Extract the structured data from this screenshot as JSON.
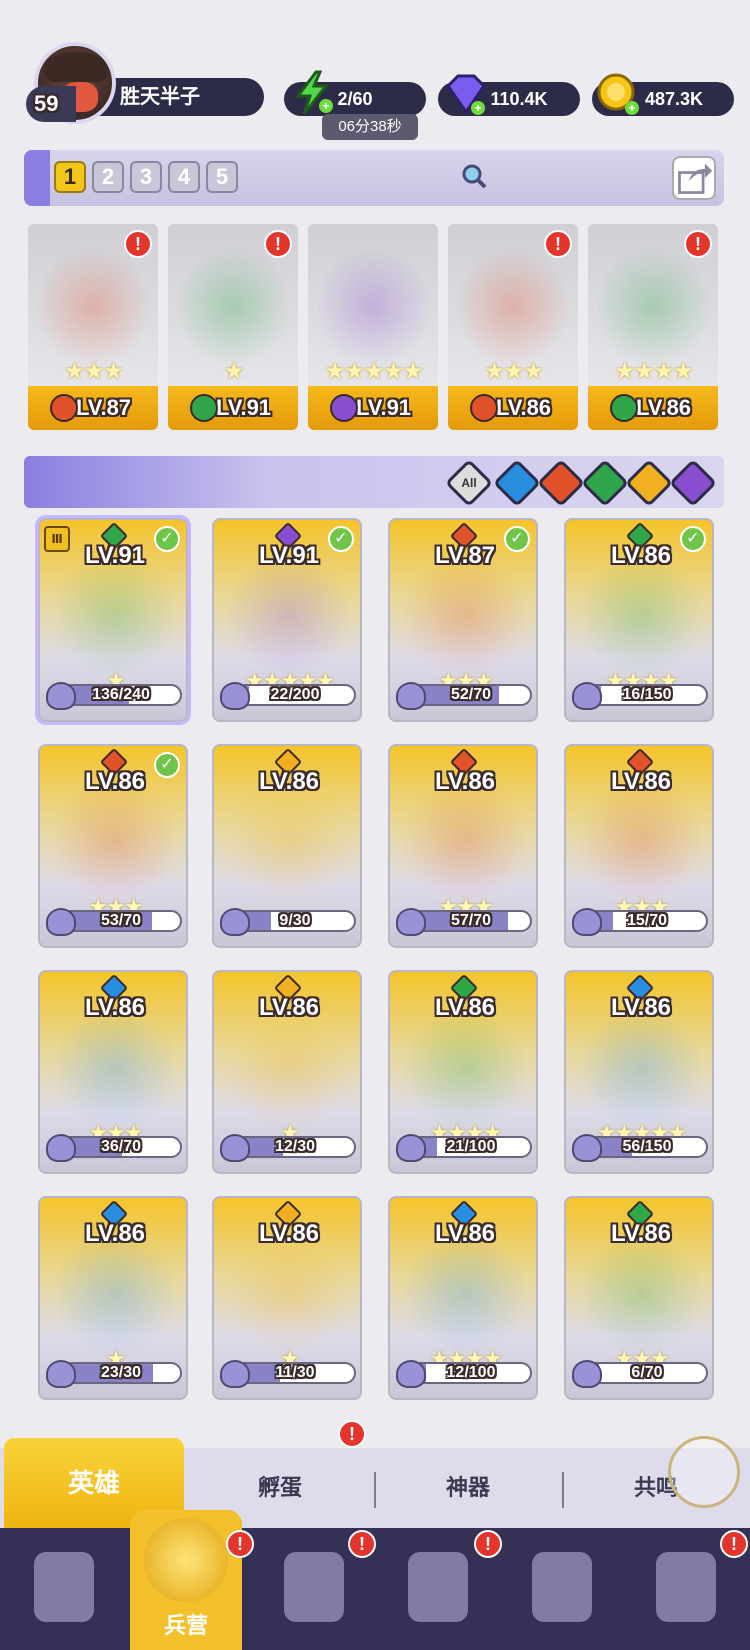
{
  "player": {
    "level": "59",
    "name": "胜天半子"
  },
  "resources": {
    "stamina": "2/60",
    "stamina_timer": "06分38秒",
    "gems": "110.4K",
    "gold": "487.3K"
  },
  "teams": {
    "tabs": [
      "1",
      "2",
      "3",
      "4",
      "5"
    ],
    "active": "1"
  },
  "team_cards": [
    {
      "level": "LV.87",
      "stars": "★★★",
      "element": "fire",
      "color": "#e2522a",
      "alert": "!"
    },
    {
      "level": "LV.91",
      "stars": "★",
      "element": "wind",
      "color": "#2fa64a",
      "alert": "!"
    },
    {
      "level": "LV.91",
      "stars": "★★★★★",
      "element": "dark",
      "color": "#8a4ed0",
      "alert": ""
    },
    {
      "level": "LV.86",
      "stars": "★★★",
      "element": "fire",
      "color": "#e2522a",
      "alert": "!"
    },
    {
      "level": "LV.86",
      "stars": "★★★★",
      "element": "wind",
      "color": "#2fa64a",
      "alert": "!"
    }
  ],
  "filters": {
    "all_label": "All",
    "elements": [
      "water",
      "fire",
      "wind",
      "light",
      "dark"
    ]
  },
  "heroes": [
    {
      "level": "LV.91",
      "stars": "★",
      "progress": "136/240",
      "ratio": 0.57,
      "element_color": "#2fa64a",
      "check": true,
      "selected": true
    },
    {
      "level": "LV.91",
      "stars": "★★★★★",
      "progress": "22/200",
      "ratio": 0.11,
      "element_color": "#8a4ed0",
      "check": true
    },
    {
      "level": "LV.87",
      "stars": "★★★",
      "progress": "52/70",
      "ratio": 0.74,
      "element_color": "#e2522a",
      "check": true
    },
    {
      "level": "LV.86",
      "stars": "★★★★",
      "progress": "16/150",
      "ratio": 0.11,
      "element_color": "#2fa64a",
      "check": true
    },
    {
      "level": "LV.86",
      "stars": "★★★",
      "progress": "53/70",
      "ratio": 0.76,
      "element_color": "#e2522a",
      "check": true
    },
    {
      "level": "LV.86",
      "stars": "",
      "progress": "9/30",
      "ratio": 0.3,
      "element_color": "#f0b020",
      "check": false
    },
    {
      "level": "LV.86",
      "stars": "★★★",
      "progress": "57/70",
      "ratio": 0.81,
      "element_color": "#e2522a",
      "check": false
    },
    {
      "level": "LV.86",
      "stars": "★★★",
      "progress": "15/70",
      "ratio": 0.21,
      "element_color": "#e2522a",
      "check": false
    },
    {
      "level": "LV.86",
      "stars": "★★★",
      "progress": "36/70",
      "ratio": 0.51,
      "element_color": "#2a8ee0",
      "check": false
    },
    {
      "level": "LV.86",
      "stars": "★",
      "progress": "12/30",
      "ratio": 0.4,
      "element_color": "#f0b020",
      "check": false
    },
    {
      "level": "LV.86",
      "stars": "★★★★",
      "progress": "21/100",
      "ratio": 0.21,
      "element_color": "#2fa64a",
      "check": false
    },
    {
      "level": "LV.86",
      "stars": "★★★★★",
      "progress": "56/150",
      "ratio": 0.37,
      "element_color": "#2a8ee0",
      "check": false
    },
    {
      "level": "LV.86",
      "stars": "★",
      "progress": "23/30",
      "ratio": 0.77,
      "element_color": "#2a8ee0",
      "check": false
    },
    {
      "level": "LV.86",
      "stars": "★",
      "progress": "11/30",
      "ratio": 0.37,
      "element_color": "#f0b020",
      "check": false
    },
    {
      "level": "LV.86",
      "stars": "★★★★",
      "progress": "12/100",
      "ratio": 0.12,
      "element_color": "#2a8ee0",
      "check": false
    },
    {
      "level": "LV.86",
      "stars": "★★★",
      "progress": "6/70",
      "ratio": 0.09,
      "element_color": "#2fa64a",
      "check": false
    }
  ],
  "sub_tabs": [
    "英雄",
    "孵蛋",
    "神器",
    "共鸣"
  ],
  "nav": {
    "active_label": "兵营",
    "alert": "!"
  }
}
